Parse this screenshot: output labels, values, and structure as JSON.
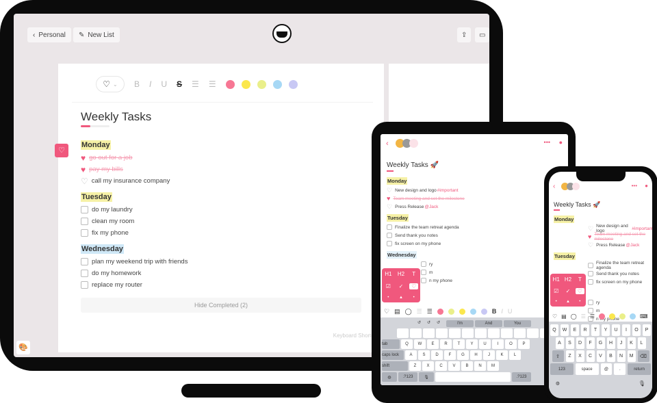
{
  "desktop": {
    "back_label": "Personal",
    "new_list_label": "New List",
    "toolbar": {
      "heart_icon": "heart-icon",
      "format": [
        "B",
        "I",
        "U",
        "S"
      ],
      "colors": [
        "#f77794",
        "#fbe74d",
        "#eaef8a",
        "#a7d8f5",
        "#c8c8f4"
      ]
    },
    "title": "Weekly Tasks",
    "progress": 0.33,
    "sections": [
      {
        "name": "Monday",
        "highlight": "#f6f1a6",
        "items": [
          {
            "text": "go out for a job",
            "type": "heart",
            "done": true
          },
          {
            "text": "pay my bills",
            "type": "heart",
            "done": true
          },
          {
            "text": "call my insurance company",
            "type": "heart",
            "done": false
          }
        ]
      },
      {
        "name": "Tuesday",
        "highlight": "#f6f1a6",
        "items": [
          {
            "text": "do my laundry",
            "type": "check"
          },
          {
            "text": "clean my room",
            "type": "check"
          },
          {
            "text": "fix my phone",
            "type": "check"
          }
        ]
      },
      {
        "name": "Wednesday",
        "highlight": "#cfe8f7",
        "items": [
          {
            "text": "plan my weekend trip with friends",
            "type": "check"
          },
          {
            "text": "do my homework",
            "type": "check"
          },
          {
            "text": "replace my router",
            "type": "check"
          }
        ]
      }
    ],
    "hide_completed": "Hide Completed (2)",
    "keyboard_shortcuts": "Keyboard Shortcuts"
  },
  "mobile": {
    "title": "Weekly Tasks 🚀",
    "monday": "Monday",
    "tuesday": "Tuesday",
    "wednesday": "Wednesday",
    "m1": "New design and logo ",
    "m1_tag": "#important",
    "m2": "Team meeting and set the milestone",
    "m3": "Press Release ",
    "m3_tag": "@Jack",
    "t1": "Finalize the team retreat agenda",
    "t2": "Send thank you notes",
    "t3": "fix screen on my phone",
    "w1": "ry",
    "w2": "m",
    "w3": "n my phone",
    "popup": [
      "H1",
      "H2",
      "T"
    ],
    "suggestions": [
      "I'm",
      "And",
      "You"
    ],
    "ipad_rows": [
      [
        "tab",
        "Q",
        "W",
        "E",
        "R",
        "T",
        "Y",
        "U",
        "I",
        "O",
        "P"
      ],
      [
        "caps lock",
        "A",
        "S",
        "D",
        "F",
        "G",
        "H",
        "J",
        "K",
        "L"
      ],
      [
        "shift",
        "Z",
        "X",
        "C",
        "V",
        "B",
        "N",
        "M"
      ]
    ],
    "ipad_bottom": [
      ".?123",
      "space",
      ".?123"
    ],
    "phone_rows": [
      [
        "Q",
        "W",
        "E",
        "R",
        "T",
        "Y",
        "U",
        "I",
        "O",
        "P"
      ],
      [
        "A",
        "S",
        "D",
        "F",
        "G",
        "H",
        "J",
        "K",
        "L"
      ],
      [
        "⇧",
        "Z",
        "X",
        "C",
        "V",
        "B",
        "N",
        "M",
        "⌫"
      ]
    ],
    "phone_bottom": [
      "123",
      "space",
      "@",
      ".",
      "return"
    ],
    "accent": "#f0587d"
  }
}
